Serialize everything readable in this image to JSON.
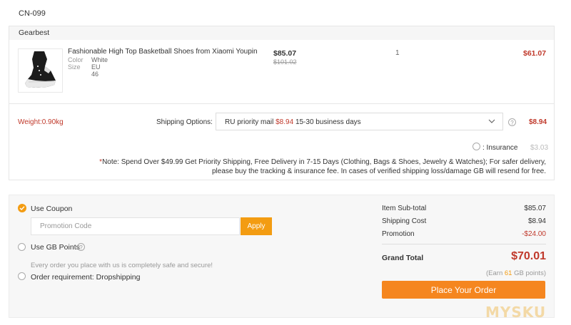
{
  "order": {
    "country": "CN-099"
  },
  "store": {
    "name": "Gearbest"
  },
  "product": {
    "name": "Fashionable High Top Basketball Shoes from Xiaomi Youpin",
    "attrs": [
      {
        "key": "Color",
        "value": "White"
      },
      {
        "key": "Size",
        "value": "EU 46"
      }
    ],
    "price": "$85.07",
    "old_price": "$101.02",
    "quantity": "1",
    "line_total": "$61.07"
  },
  "shipping": {
    "weight": "Weight:0.90kg",
    "label": "Shipping Options:",
    "method": "RU priority mail",
    "method_price": "$8.94",
    "method_days": "15-30 business days",
    "cost": "$8.94",
    "help_icon": "question-icon",
    "chevron_icon": "chevron-down-icon",
    "insurance_label": ": Insurance",
    "insurance_cost": "$3.03",
    "note_mark": "*",
    "note_text": "Note: Spend Over $49.99 Get Priority Shipping, Free Delivery in 7-15 Days (Clothing, Bags & Shoes, Jewelry & Watches); For safer delivery, please buy the tracking & insurance fee. In cases of verified shipping loss/damage GB will resend for free."
  },
  "payment": {
    "coupon_label": "Use Coupon",
    "coupon_checked": true,
    "promo_placeholder": "Promotion Code",
    "apply_label": "Apply",
    "gb_points_label": "Use GB Points",
    "safe_text": "Every order you place with us is completely safe and secure!",
    "order_requirement": "Order requirement: Dropshipping"
  },
  "summary": {
    "subtotal_label": "Item Sub-total",
    "subtotal_value": "$85.07",
    "shipping_label": "Shipping Cost",
    "shipping_value": "$8.94",
    "promotion_label": "Promotion",
    "promotion_value": "-$24.00",
    "grand_label": "Grand Total",
    "grand_value": "$70.01",
    "earn_prefix": "(Earn",
    "earn_points": "61",
    "earn_suffix": "GB points)",
    "place_order_label": "Place Your Order"
  },
  "watermark": {
    "text": "MYSKU"
  },
  "colors": {
    "accent_orange": "#f39c12",
    "place_order_orange": "#f5861f",
    "price_red": "#c0392b"
  }
}
